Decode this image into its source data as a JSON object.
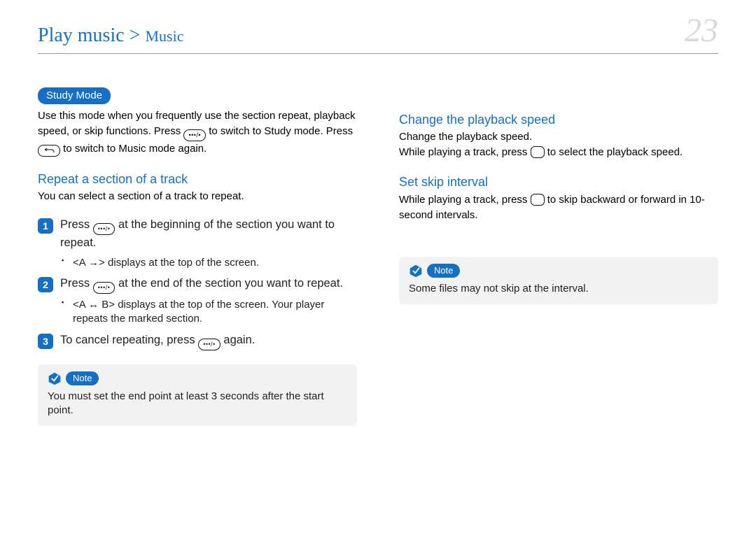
{
  "header": {
    "breadcrumb_main": "Play music",
    "breadcrumb_sep": " > ",
    "breadcrumb_sub": "Music",
    "page_number": "23"
  },
  "left": {
    "study_mode_pill": "Study Mode",
    "study_mode_text_a": "Use this mode when you frequently use the section repeat, playback speed, or skip functions. Press ",
    "study_mode_text_b": " to switch to Study mode. Press ",
    "study_mode_text_c": " to switch to Music mode again.",
    "repeat_heading": "Repeat a section of a track",
    "repeat_intro": "You can select a section of a track to repeat.",
    "step1_a": "Press ",
    "step1_b": " at the beginning of the section you want to repeat.",
    "step1_sub": "<A →> displays at the top of the screen.",
    "step2_a": "Press ",
    "step2_b": " at the end of the section you want to repeat.",
    "step2_sub": "<A ↔ B> displays at the top of the screen. Your player repeats the marked section.",
    "step3_a": "To cancel repeating, press ",
    "step3_b": " again.",
    "note_label": "Note",
    "note_text": "You must set the end point at least 3 seconds after the start point."
  },
  "right": {
    "change_speed_heading": "Change the playback speed",
    "change_speed_intro": "Change the playback speed.",
    "change_speed_a": "While playing a track, press ",
    "change_speed_b": " to select the playback speed.",
    "skip_heading": "Set skip interval",
    "skip_a": "While playing a track, press ",
    "skip_b": " to skip backward or forward in 10-second intervals.",
    "note_label": "Note",
    "note_text": "Some files may not skip at the interval."
  }
}
